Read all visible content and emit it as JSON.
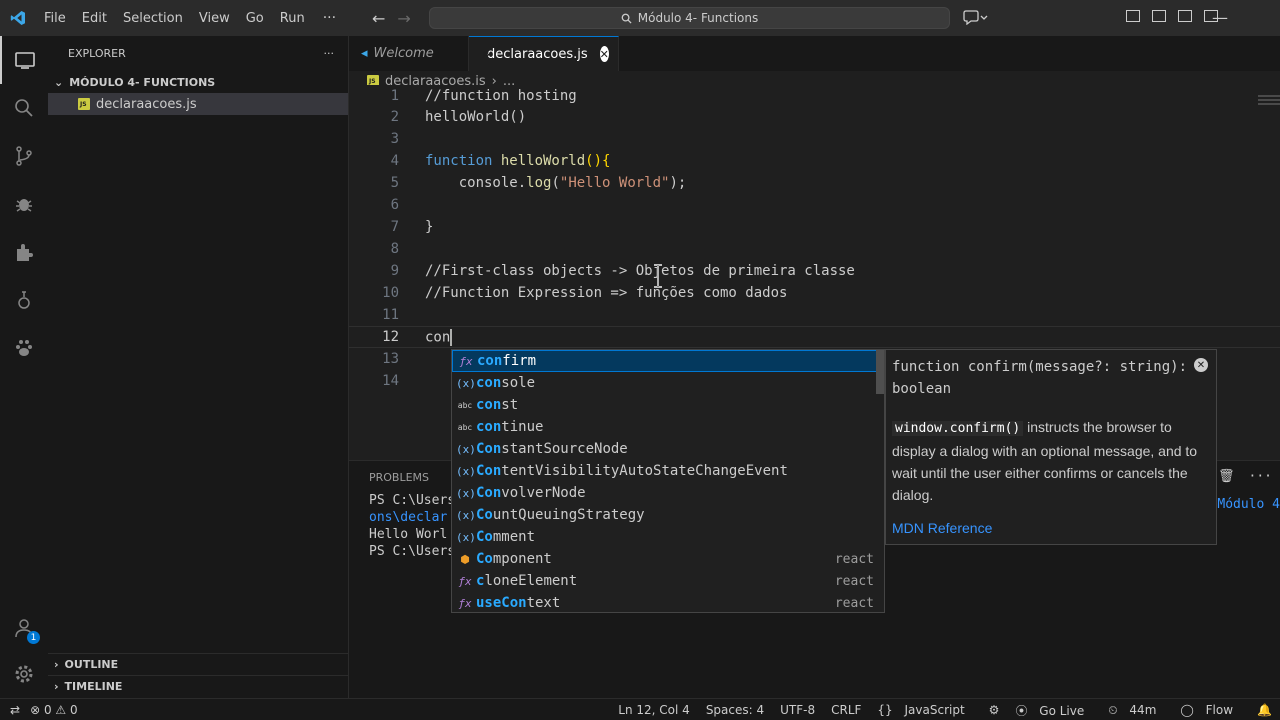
{
  "menu": [
    "File",
    "Edit",
    "Selection",
    "View",
    "Go",
    "Run",
    "···"
  ],
  "search_text": "Módulo 4- Functions",
  "explorer": {
    "title": "EXPLORER",
    "more": "···",
    "folder": "MÓDULO 4- FUNCTIONS",
    "file": "declaraacoes.js",
    "outline": "OUTLINE",
    "timeline": "TIMELINE"
  },
  "tabs": {
    "welcome": "Welcome",
    "active": "declaraacoes.js"
  },
  "breadcrumb": {
    "file": "declaraacoes.js",
    "sep": "›",
    "rest": "..."
  },
  "editor": {
    "line1": "//function hosting",
    "line2": "helloWorld()",
    "line4_kw": "function ",
    "line4_fn": "helloWorld",
    "line4_rest": "(){",
    "line5_a": "    console.",
    "line5_fn": "log",
    "line5_str": "\"Hello World\"",
    "line5_end": ");",
    "line7": "}",
    "line9": "//First-class objects -> Objetos de primeira classe",
    "line10": "//Function Expression => funções como dados",
    "line12": "con",
    "line_numbers": [
      "1",
      "2",
      "3",
      "4",
      "5",
      "6",
      "7",
      "8",
      "9",
      "10",
      "11",
      "12",
      "13",
      "14"
    ]
  },
  "panel": {
    "tab": "PROBLEMS",
    "lines": [
      "PS C:\\Users",
      "ons\\declar",
      "Hello Worl",
      "PS C:\\Users"
    ],
    "right_text": "\\Módulo 4"
  },
  "suggest": [
    {
      "icon": "fx",
      "pre": "con",
      "rest": "firm",
      "source": ""
    },
    {
      "icon": "var",
      "pre": "con",
      "rest": "sole",
      "source": ""
    },
    {
      "icon": "kw",
      "pre": "con",
      "rest": "st",
      "source": ""
    },
    {
      "icon": "kw",
      "pre": "con",
      "rest": "tinue",
      "source": ""
    },
    {
      "icon": "var",
      "pre": "Con",
      "rest": "stantSourceNode",
      "source": ""
    },
    {
      "icon": "var",
      "pre": "Con",
      "rest": "tentVisibilityAutoStateChangeEvent",
      "source": ""
    },
    {
      "icon": "var",
      "pre": "Con",
      "rest": "volverNode",
      "source": ""
    },
    {
      "icon": "var",
      "pre": "Co",
      "rest": "untQueuingStrategy",
      "source": ""
    },
    {
      "icon": "var",
      "pre": "Co",
      "rest": "mment",
      "source": ""
    },
    {
      "icon": "cls",
      "pre": "Co",
      "rest": "mponent",
      "source": "react"
    },
    {
      "icon": "fx",
      "pre": "c",
      "rest": "loneElement",
      "source": "react"
    },
    {
      "icon": "fx",
      "pre": "useCon",
      "rest": "text",
      "source": "react"
    }
  ],
  "details": {
    "signature": "function confirm(message?: string): boolean",
    "code": "window.confirm()",
    "doc": " instructs the browser to display a dialog with an optional message, and to wait until the user either confirms or cancels the dialog.",
    "link": "MDN Reference"
  },
  "status": {
    "errors": "0",
    "warnings": "0",
    "position": "Ln 12, Col 4",
    "spaces": "Spaces: 4",
    "encoding": "UTF-8",
    "eol": "CRLF",
    "language": "JavaScript",
    "golive": "Go Live",
    "time": "44m",
    "flow": "Flow"
  },
  "accounts_badge": "1",
  "colors": {
    "accent": "#0078d4",
    "selection": "#04395e",
    "link": "#3794ff"
  }
}
